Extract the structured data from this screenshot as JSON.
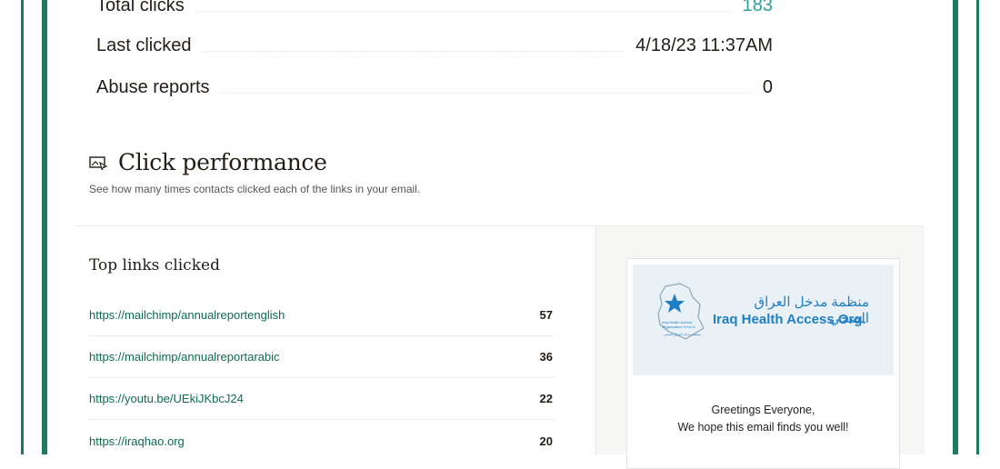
{
  "stats": [
    {
      "label": "Total clicks",
      "value": "183",
      "accent": "#2aa198"
    },
    {
      "label": "Last clicked",
      "value": "4/18/23 11:37AM"
    },
    {
      "label": "Abuse reports",
      "value": "0"
    }
  ],
  "click_performance": {
    "icon": "image-cursor-icon",
    "title": "Click performance",
    "subtitle": "See how many times contacts clicked each of the links in your email."
  },
  "top_links": {
    "title": "Top links clicked",
    "rows": [
      {
        "url": "https://mailchimp/annualreportenglish",
        "count": "57"
      },
      {
        "url": "https://mailchimp/annualreportarabic",
        "count": "36"
      },
      {
        "url": "https://youtu.be/UEkiJKbcJ24",
        "count": "22"
      },
      {
        "url": "https://iraqhao.org",
        "count": "20"
      }
    ]
  },
  "email_preview": {
    "logo_arabic": "منظمة مدخل العراق الصحي",
    "logo_english": "Iraq Health Access Org.",
    "greeting_line1": "Greetings Everyone,",
    "greeting_line2": "We hope this email finds you well!"
  },
  "colors": {
    "frame": "#1e7b62",
    "link": "#0f6b51",
    "logo_blue": "#1f7fc5"
  }
}
